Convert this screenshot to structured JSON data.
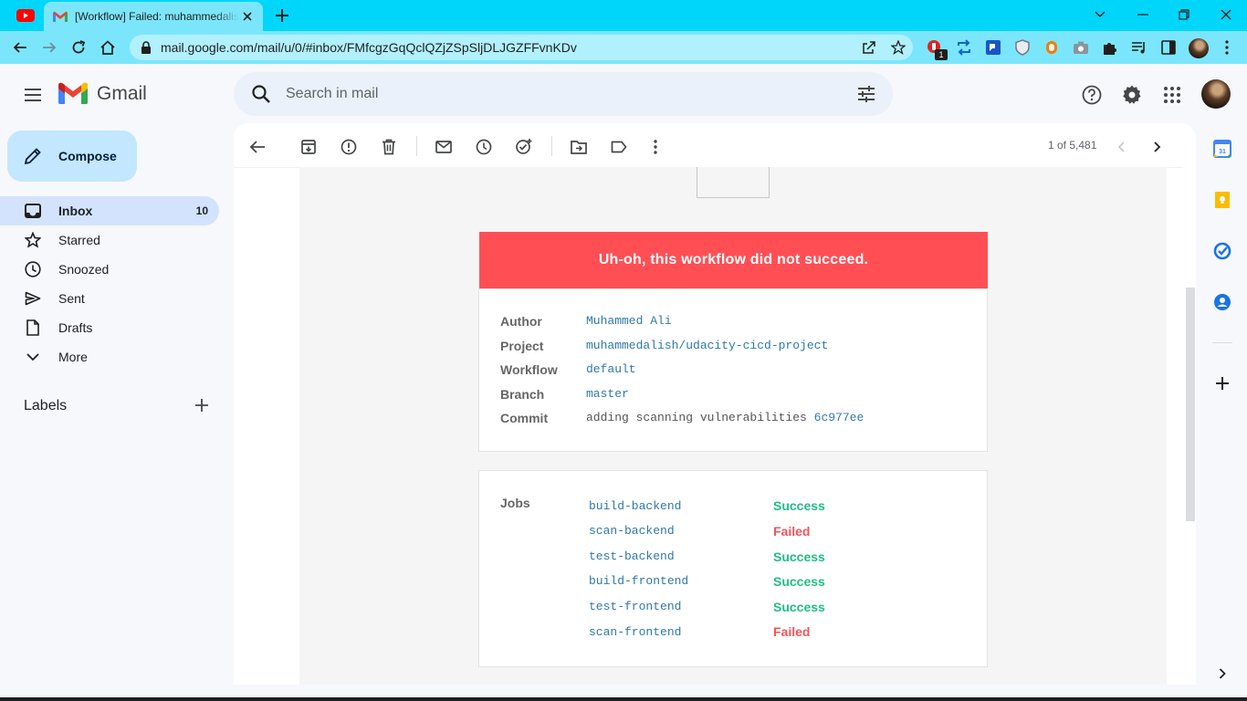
{
  "browser": {
    "tab_title": "[Workflow] Failed: muhammedalish/udacity-cicd-project",
    "url": "mail.google.com/mail/u/0/#inbox/FMfcgzGqQclQZjZSpSljDLJGZFFvnKDv",
    "ext_badge": "1"
  },
  "gmail": {
    "brand": "Gmail",
    "search_placeholder": "Search in mail",
    "compose_label": "Compose",
    "nav": [
      {
        "label": "Inbox",
        "count": "10"
      },
      {
        "label": "Starred"
      },
      {
        "label": "Snoozed"
      },
      {
        "label": "Sent"
      },
      {
        "label": "Drafts"
      },
      {
        "label": "More"
      }
    ],
    "labels_heading": "Labels",
    "pager": "1 of 5,481"
  },
  "email": {
    "banner": "Uh-oh, this workflow did not succeed.",
    "details": [
      {
        "key": "Author",
        "value": "Muhammed Ali"
      },
      {
        "key": "Project",
        "value": "muhammedalish/udacity-cicd-project"
      },
      {
        "key": "Workflow",
        "value": "default"
      },
      {
        "key": "Branch",
        "value": "master"
      },
      {
        "key": "Commit",
        "value": "adding scanning vulnerabilities",
        "hash": "6c977ee"
      }
    ],
    "jobs_label": "Jobs",
    "jobs": [
      {
        "name": "build-backend",
        "status": "Success"
      },
      {
        "name": "scan-backend",
        "status": "Failed"
      },
      {
        "name": "test-backend",
        "status": "Success"
      },
      {
        "name": "build-frontend",
        "status": "Success"
      },
      {
        "name": "test-frontend",
        "status": "Success"
      },
      {
        "name": "scan-frontend",
        "status": "Failed"
      }
    ]
  },
  "colors": {
    "accent_bar": "#00d5fa",
    "banner_red": "#ff4f54",
    "success_green": "#1fbf83",
    "failed_red": "#f2545b",
    "link_blue": "#2f78a9"
  }
}
